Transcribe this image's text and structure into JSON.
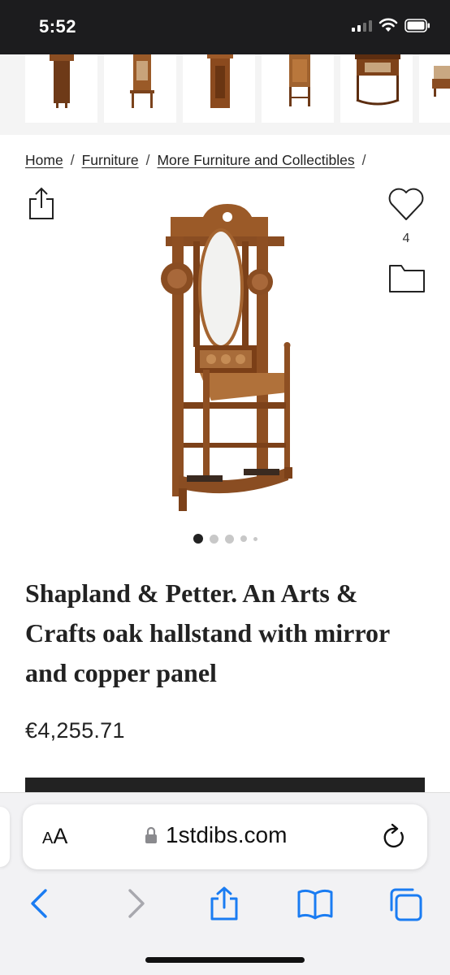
{
  "status_bar": {
    "time": "5:52"
  },
  "breadcrumb": {
    "items": [
      "Home",
      "Furniture",
      "More Furniture and Collectibles"
    ],
    "separator": "/"
  },
  "favorites": {
    "count": "4"
  },
  "carousel": {
    "dot_count": 5,
    "active_index": 0
  },
  "product": {
    "title": "Shapland & Petter. An Arts & Crafts oak hallstand with mirror and copper panel",
    "price": "€4,255.71"
  },
  "browser": {
    "text_size_label_big": "A",
    "text_size_label_small": "A",
    "domain": "1stdibs.com"
  },
  "colors": {
    "accent": "#1a7cf2",
    "dark": "#222222",
    "wood": "#8a4d22"
  },
  "icons": {
    "share": "share-icon",
    "heart": "heart-icon",
    "folder": "folder-icon",
    "lock": "lock-icon",
    "reload": "reload-icon",
    "back": "back-arrow-icon",
    "forward": "forward-arrow-icon",
    "bookmarks": "book-icon",
    "tabs": "tabs-icon"
  }
}
